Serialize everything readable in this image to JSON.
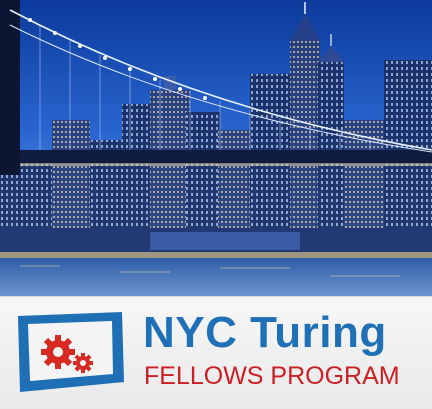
{
  "banner": {
    "title": "NYC Turing",
    "subtitle": "FELLOWS PROGRAM"
  },
  "icons": {
    "logo": "monitor-with-gears-icon"
  },
  "colors": {
    "title_blue": "#1f70b6",
    "subtitle_red": "#cc1f23",
    "logo_blue": "#1f6fb4",
    "gear_red": "#d62a22"
  }
}
